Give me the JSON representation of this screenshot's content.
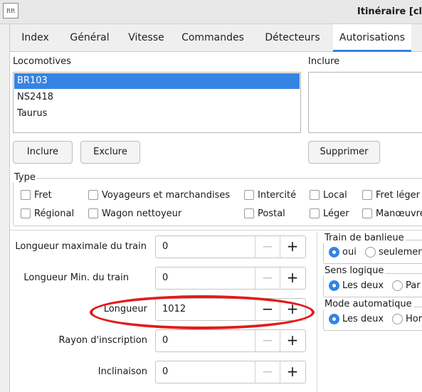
{
  "window": {
    "title": "Itinéraire [cl"
  },
  "app_icon": {
    "name": "app-icon"
  },
  "tabs": [
    {
      "label": "Index"
    },
    {
      "label": "Général"
    },
    {
      "label": "Vitesse"
    },
    {
      "label": "Commandes"
    },
    {
      "label": "Détecteurs"
    },
    {
      "label": "Autorisations",
      "active": true
    }
  ],
  "locomotives": {
    "label": "Locomotives",
    "items": [
      {
        "label": "BR103",
        "selected": true
      },
      {
        "label": "NS2418"
      },
      {
        "label": "Taurus"
      }
    ],
    "include_button": "Inclure",
    "exclude_button": "Exclure"
  },
  "include_list": {
    "label": "Inclure",
    "delete_button": "Supprimer"
  },
  "type_group": {
    "title": "Type",
    "options": [
      {
        "label": "Fret",
        "checked": false
      },
      {
        "label": "Voyageurs et marchandises",
        "checked": false
      },
      {
        "label": "Intercité",
        "checked": false
      },
      {
        "label": "Local",
        "checked": false
      },
      {
        "label": "Fret léger",
        "checked": false
      },
      {
        "label": "Régional",
        "checked": false
      },
      {
        "label": "Wagon nettoyeur",
        "checked": false
      },
      {
        "label": "Postal",
        "checked": false
      },
      {
        "label": "Léger",
        "checked": false
      },
      {
        "label": "Manœuvre",
        "checked": false
      }
    ]
  },
  "fields": [
    {
      "label": "Longueur maximale du train",
      "value": "0",
      "minus": "−",
      "plus": "+"
    },
    {
      "label": "Longueur Min. du train",
      "value": "0",
      "minus": "−",
      "plus": "+"
    },
    {
      "label": "Longueur",
      "value": "1012",
      "minus": "−",
      "plus": "+"
    },
    {
      "label": "Rayon d'inscription",
      "value": "0",
      "minus": "−",
      "plus": "+"
    },
    {
      "label": "Inclinaison",
      "value": "0",
      "minus": "−",
      "plus": "+"
    }
  ],
  "right_groups": [
    {
      "title": "Train de banlieue",
      "options": [
        {
          "label": "oui",
          "selected": true
        },
        {
          "label": "seulemen",
          "selected": false
        }
      ]
    },
    {
      "title": "Sens logique",
      "options": [
        {
          "label": "Les deux",
          "selected": true
        },
        {
          "label": "Par",
          "selected": false
        }
      ]
    },
    {
      "title": "Mode automatique",
      "options": [
        {
          "label": "Les deux",
          "selected": true
        },
        {
          "label": "Hor",
          "selected": false
        }
      ]
    }
  ],
  "colors": {
    "accent": "#3584e4",
    "annotation": "#e21b1b"
  }
}
